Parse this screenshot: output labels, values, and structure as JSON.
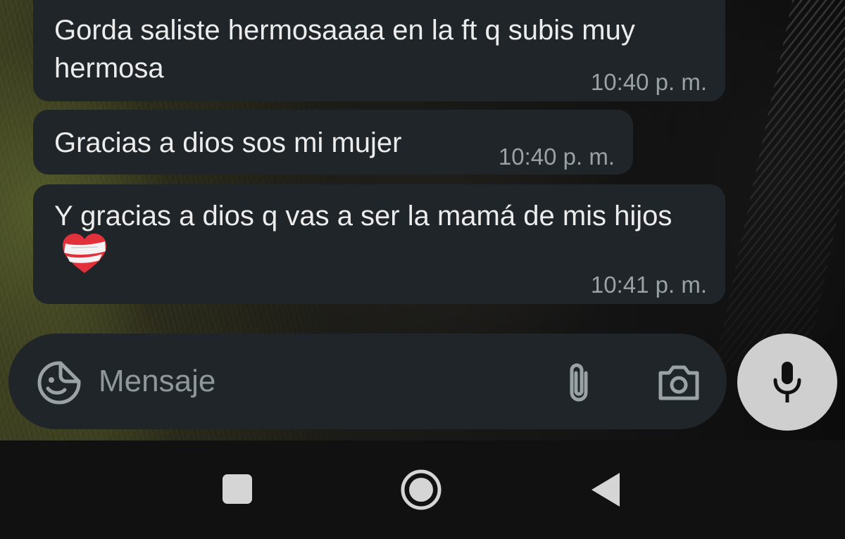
{
  "messages": [
    {
      "text": "Gorda saliste hermosaaaa en la ft q subis muy hermosa",
      "time": "10:40 p. m."
    },
    {
      "text": "Gracias a dios sos mi mujer",
      "time": "10:40 p. m."
    },
    {
      "text": "Y gracias a dios q vas a ser la mamá de mis hijos",
      "emoji": "mending-heart-emoji",
      "time": "10:41 p. m."
    }
  ],
  "composer": {
    "placeholder": "Mensaje",
    "icons": {
      "sticker": "sticker-smiley-icon",
      "attach": "paperclip-icon",
      "camera": "camera-icon",
      "mic": "microphone-icon"
    }
  },
  "navigation": {
    "icons": [
      "recents-square-icon",
      "home-circle-icon",
      "back-triangle-icon"
    ]
  },
  "colors": {
    "bubble": "#1f2528",
    "text": "#ececec",
    "timestamp": "#9aa2a6",
    "placeholder": "#8f979b",
    "mic_button": "#cfcfcf",
    "nav_bar": "#111111"
  }
}
